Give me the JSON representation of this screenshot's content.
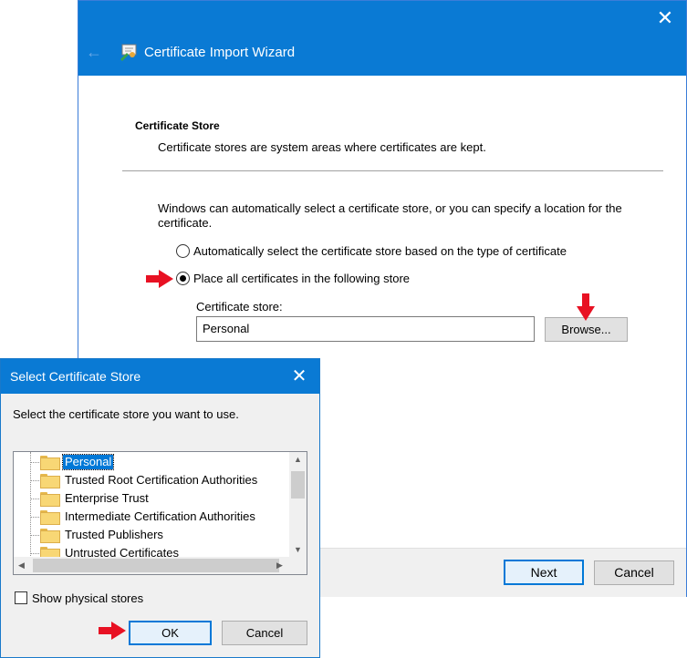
{
  "wizard": {
    "title": "Certificate Import Wizard",
    "close_glyph": "✕",
    "back_glyph": "←",
    "section_title": "Certificate Store",
    "section_desc": "Certificate stores are system areas where certificates are kept.",
    "intro": "Windows can automatically select a certificate store, or you can specify a location for the certificate.",
    "radio_auto_label": "Automatically select the certificate store based on the type of certificate",
    "radio_place_label": "Place all certificates in the following store",
    "selected_option": "place",
    "store_label": "Certificate store:",
    "store_value": "Personal",
    "browse_label": "Browse...",
    "next_label": "Next",
    "cancel_label": "Cancel"
  },
  "dialog": {
    "title": "Select Certificate Store",
    "close_glyph": "✕",
    "prompt": "Select the certificate store you want to use.",
    "stores": [
      "Personal",
      "Trusted Root Certification Authorities",
      "Enterprise Trust",
      "Intermediate Certification Authorities",
      "Trusted Publishers",
      "Untrusted Certificates"
    ],
    "selected_store": "Personal",
    "show_physical_label": "Show physical stores",
    "show_physical_checked": false,
    "ok_label": "OK",
    "cancel_label": "Cancel"
  },
  "icons": {
    "wizard_icon": "certificate-icon",
    "tree_item_icon": "folder-icon",
    "annotation": "red-arrow"
  },
  "colors": {
    "title_bar": "#0a7ad4",
    "selection": "#0078d7",
    "annotation_arrow": "#e81123"
  }
}
